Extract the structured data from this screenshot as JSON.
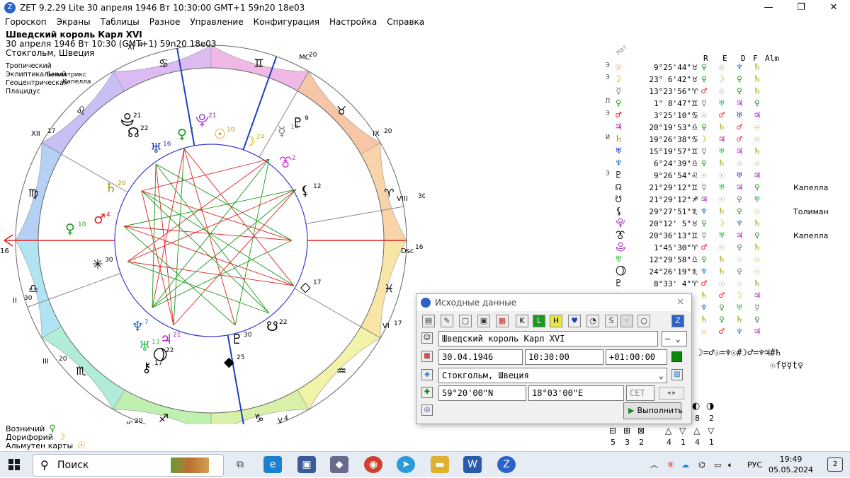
{
  "window": {
    "title": "ZET 9.2.29 Lite   30 апреля 1946  Вт  10:30:00 GMT+1 59n20  18e03",
    "minimize": "—",
    "maximize": "❐",
    "close": "✕"
  },
  "menu": [
    "Гороскоп",
    "Экраны",
    "Таблицы",
    "Разное",
    "Управление",
    "Конфигурация",
    "Настройка",
    "Справка"
  ],
  "chart_header": {
    "name": "Шведский король Карл XVI",
    "datetime": "30 апреля 1946  Вт  10:30 (GMT+1) 59n20  18e03",
    "place": "Стокгольм, Швеция"
  },
  "calc_settings": [
    "Тропический",
    "Эклиптикальный",
    "Геоцентрическая",
    "Плацидус"
  ],
  "fixed_stars_left": [
    "Беллатрикс",
    "Капелла"
  ],
  "wheel": {
    "asc_label": "Asc",
    "asc_deg": "16",
    "dsc_label": "Dsc",
    "dsc_deg": "16",
    "mc_label": "MC",
    "mc_deg": "20",
    "ic_label": "IC",
    "ic_deg": "20",
    "houses": [
      {
        "num": "II",
        "deg": "30"
      },
      {
        "num": "III",
        "deg": "20"
      },
      {
        "num": "V",
        "deg": "4"
      },
      {
        "num": "VI",
        "deg": "17"
      },
      {
        "num": "VIII",
        "deg": "30"
      },
      {
        "num": "IX",
        "deg": "20"
      },
      {
        "num": "XI",
        "deg": "4"
      },
      {
        "num": "XII",
        "deg": "17"
      }
    ],
    "star_bottom": "Толиман",
    "planets_on_wheel": [
      {
        "glyph": "♀",
        "deg": "10",
        "color": "#1a9a1a"
      },
      {
        "glyph": "♂",
        "deg": "4",
        "color": "#e02020"
      },
      {
        "glyph": "♄",
        "deg": "20",
        "color": "#999900"
      },
      {
        "glyph": "☊",
        "deg": "22",
        "color": "#000"
      },
      {
        "glyph": "♅",
        "deg": "16",
        "color": "#1a40c0"
      },
      {
        "glyph": "♀",
        "deg": "2",
        "color": "#1a9a1a"
      },
      {
        "glyph": "⯓",
        "deg": "21",
        "color": "#9a30c0"
      },
      {
        "glyph": "☉",
        "deg": "10",
        "color": "#e08a00"
      },
      {
        "glyph": "☽",
        "deg": "24",
        "color": "#d4b000"
      },
      {
        "glyph": "☿",
        "deg": "14",
        "color": "#888"
      },
      {
        "glyph": "♇",
        "deg": "9",
        "color": "#000"
      },
      {
        "glyph": "⯔",
        "deg": "2",
        "color": "#e020e0"
      },
      {
        "glyph": "⚸",
        "deg": "12",
        "color": "#000"
      },
      {
        "glyph": "✳",
        "deg": "30",
        "color": "#000"
      },
      {
        "glyph": "◇",
        "deg": "17",
        "color": "#000"
      },
      {
        "glyph": "☋",
        "deg": "22",
        "color": "#000"
      },
      {
        "glyph": "♇",
        "deg": "30",
        "color": "#000"
      },
      {
        "glyph": "◆",
        "deg": "25",
        "color": "#000"
      },
      {
        "glyph": "♃",
        "deg": "21",
        "color": "#b020c0"
      },
      {
        "glyph": "♆",
        "deg": "7",
        "color": "#1a70d0"
      },
      {
        "glyph": "♅",
        "deg": "13",
        "color": "#20c040"
      },
      {
        "glyph": "⚷",
        "deg": "17",
        "color": "#000"
      },
      {
        "glyph": "⯕",
        "deg": "21",
        "color": "#000"
      },
      {
        "glyph": "⯖",
        "deg": "22",
        "color": "#000"
      }
    ]
  },
  "bottom_info": [
    {
      "label": "Возничий",
      "glyph": "♀",
      "color": "#1a9a1a"
    },
    {
      "label": "Дорифорий",
      "glyph": "☽",
      "color": "#d4b000"
    },
    {
      "label": "Альмутен карты",
      "glyph": "☉",
      "color": "#e08a00"
    }
  ],
  "table": {
    "header_nat": "Нат",
    "col_headers": [
      "R",
      "E",
      "D",
      "F",
      "Alm"
    ],
    "rows": [
      {
        "pre": "Э",
        "glyph": "☉",
        "gcol": "#e08a00",
        "deg": "9°25'44\"",
        "sign": "♉",
        "r": [
          "♀",
          "☉",
          "♆",
          "♄"
        ],
        "rc": [
          "#1a9a1a",
          "#e08a00",
          "#1a70d0",
          "#999900"
        ],
        "star": ""
      },
      {
        "pre": "Э",
        "glyph": "☽",
        "gcol": "#d4b000",
        "deg": "23° 6'42\"",
        "sign": "♉",
        "r": [
          "♀",
          "☽",
          "♀",
          "♄"
        ],
        "rc": [
          "#1a9a1a",
          "#d4b000",
          "#1a9a1a",
          "#999900"
        ],
        "star": ""
      },
      {
        "pre": "",
        "glyph": "☿",
        "gcol": "#888",
        "deg": "13°23'56\"",
        "sign": "♈",
        "r": [
          "♂",
          "☉",
          "♀",
          "♄"
        ],
        "rc": [
          "#e02020",
          "#e08a00",
          "#1a9a1a",
          "#999900"
        ],
        "star": ""
      },
      {
        "pre": "П",
        "glyph": "♀",
        "gcol": "#1a9a1a",
        "deg": "1° 8'47\"",
        "sign": "♊",
        "r": [
          "☿",
          "♅",
          "♃",
          "♀"
        ],
        "rc": [
          "#888",
          "#20c040",
          "#b020c0",
          "#1a9a1a"
        ],
        "star": ""
      },
      {
        "pre": "Э",
        "glyph": "♂",
        "gcol": "#e02020",
        "deg": "3°25'10\"",
        "sign": "♋",
        "r": [
          "☉",
          "♂",
          "♅",
          "♃"
        ],
        "rc": [
          "#e08a00",
          "#e02020",
          "#1a40c0",
          "#b020c0"
        ],
        "star": ""
      },
      {
        "pre": "",
        "glyph": "♃",
        "gcol": "#b020c0",
        "deg": "20°19'53\"",
        "sign": "♎",
        "r": [
          "♀",
          "♄",
          "♂",
          "☉"
        ],
        "rc": [
          "#1a9a1a",
          "#999900",
          "#e02020",
          "#e08a00"
        ],
        "star": ""
      },
      {
        "pre": "И",
        "glyph": "♄",
        "gcol": "#999900",
        "deg": "19°26'38\"",
        "sign": "♋",
        "r": [
          "☽",
          "♃",
          "♂",
          "☉"
        ],
        "rc": [
          "#d4b000",
          "#b020c0",
          "#e02020",
          "#e08a00"
        ],
        "star": ""
      },
      {
        "pre": "",
        "glyph": "♅",
        "gcol": "#1a40c0",
        "deg": "15°19'57\"",
        "sign": "♊",
        "r": [
          "☿",
          "♅",
          "♃",
          "♄"
        ],
        "rc": [
          "#888",
          "#20c040",
          "#b020c0",
          "#999900"
        ],
        "star": ""
      },
      {
        "pre": "",
        "glyph": "♆",
        "gcol": "#1a70d0",
        "deg": "6°24'39\"",
        "sign": "♎",
        "r": [
          "♀",
          "♄",
          "☉",
          "☉"
        ],
        "rc": [
          "#1a9a1a",
          "#999900",
          "#e08a00",
          "#e08a00"
        ],
        "star": ""
      },
      {
        "pre": "Э",
        "glyph": "♇",
        "gcol": "#000",
        "deg": "9°26'54\"",
        "sign": "♌",
        "r": [
          "☉",
          "☉",
          "♅",
          "♃"
        ],
        "rc": [
          "#e08a00",
          "#e08a00",
          "#1a40c0",
          "#b020c0"
        ],
        "star": ""
      },
      {
        "pre": "",
        "glyph": "☊",
        "gcol": "#000",
        "deg": "21°29'12\"",
        "sign": "♊",
        "r": [
          "☿",
          "♅",
          "♃",
          "♀"
        ],
        "rc": [
          "#888",
          "#20c040",
          "#b020c0",
          "#1a9a1a"
        ],
        "star": "Капелла"
      },
      {
        "pre": "",
        "glyph": "☋",
        "gcol": "#000",
        "deg": "21°29'12\"",
        "sign": "♐",
        "r": [
          "♃",
          "☉",
          "♀",
          "♅"
        ],
        "rc": [
          "#b020c0",
          "#e08a00",
          "#1a9a1a",
          "#20c040"
        ],
        "star": ""
      },
      {
        "pre": "",
        "glyph": "⚸",
        "gcol": "#000",
        "deg": "29°27'51\"",
        "sign": "♏",
        "r": [
          "♆",
          "♄",
          "♀",
          "☉"
        ],
        "rc": [
          "#1a70d0",
          "#999900",
          "#1a9a1a",
          "#e08a00"
        ],
        "star": "Толиман"
      },
      {
        "pre": "",
        "glyph": "⯓",
        "gcol": "#9a30c0",
        "deg": "20°12' 5\"",
        "sign": "♉",
        "r": [
          "♀",
          "☽",
          "♆",
          "♄"
        ],
        "rc": [
          "#1a9a1a",
          "#d4b000",
          "#1a70d0",
          "#999900"
        ],
        "star": ""
      },
      {
        "pre": "",
        "glyph": "⯔",
        "gcol": "#000",
        "deg": "20°36'13\"",
        "sign": "♊",
        "r": [
          "☿",
          "♅",
          "♃",
          "♀"
        ],
        "rc": [
          "#888",
          "#20c040",
          "#b020c0",
          "#1a9a1a"
        ],
        "star": "Капелла"
      },
      {
        "pre": "",
        "glyph": "⯕",
        "gcol": "#9a30c0",
        "deg": "1°45'30\"",
        "sign": "♈",
        "r": [
          "♂",
          "☉",
          "♀",
          "♄"
        ],
        "rc": [
          "#e02020",
          "#e08a00",
          "#1a9a1a",
          "#999900"
        ],
        "star": ""
      },
      {
        "pre": "",
        "glyph": "♅",
        "gcol": "#20c040",
        "deg": "12°29'58\"",
        "sign": "♎",
        "r": [
          "♀",
          "♄",
          "☉",
          "☉"
        ],
        "rc": [
          "#1a9a1a",
          "#999900",
          "#e08a00",
          "#e08a00"
        ],
        "star": ""
      },
      {
        "pre": "",
        "glyph": "⯖",
        "gcol": "#000",
        "deg": "24°26'19\"",
        "sign": "♏",
        "r": [
          "♆",
          "♄",
          "♀",
          "☉"
        ],
        "rc": [
          "#1a70d0",
          "#999900",
          "#1a9a1a",
          "#e08a00"
        ],
        "star": ""
      },
      {
        "pre": "",
        "glyph": "♇",
        "gcol": "#000",
        "deg": "8°33' 4\"",
        "sign": "♈",
        "r": [
          "♂",
          "☉",
          "☉",
          "♄"
        ],
        "rc": [
          "#e02020",
          "#e08a00",
          "#e08a00",
          "#999900"
        ],
        "star": ""
      },
      {
        "pre": "",
        "glyph": "◇",
        "gcol": "#000",
        "deg": "",
        "sign": "",
        "r": [
          "♄",
          "♂",
          "☽",
          "♃"
        ],
        "rc": [
          "#999900",
          "#e02020",
          "#d4b000",
          "#b020c0"
        ],
        "star": ""
      },
      {
        "pre": "",
        "glyph": "",
        "gcol": "#000",
        "deg": "",
        "sign": "",
        "r": [
          "♆",
          "♀",
          "♅",
          "☿"
        ],
        "rc": [
          "#1a70d0",
          "#1a9a1a",
          "#20c040",
          "#888"
        ],
        "star": ""
      },
      {
        "pre": "",
        "glyph": "",
        "gcol": "#000",
        "deg": "",
        "sign": "",
        "r": [
          "♄",
          "♀",
          "♄",
          "♀"
        ],
        "rc": [
          "#999900",
          "#1a9a1a",
          "#999900",
          "#1a9a1a"
        ],
        "star": ""
      },
      {
        "pre": "",
        "glyph": "",
        "gcol": "#000",
        "deg": "",
        "sign": "",
        "r": [
          "☉",
          "♂",
          "♆",
          "♃"
        ],
        "rc": [
          "#e08a00",
          "#e02020",
          "#1a70d0",
          "#b020c0"
        ],
        "star": ""
      }
    ],
    "formula1": "☽=♂☉=♆☉#☽♂=♆♃#♄",
    "formula2": "☉f☿☿t♀"
  },
  "bottom_right": {
    "row1_icons": [
      "◐",
      "◑"
    ],
    "row1_nums": [
      "8",
      "2"
    ],
    "row2_icons": [
      "⊟",
      "⊞",
      "⊠",
      "△",
      "▽",
      "△",
      "▽"
    ],
    "row2_nums": [
      "5",
      "3",
      "2",
      "4",
      "1",
      "4",
      "1"
    ]
  },
  "dialog": {
    "title": "Исходные данные",
    "close": "✕",
    "name_value": "Шведский король Карл XVI",
    "gender_value": "—",
    "date_value": "30.04.1946",
    "time_value": "10:30:00",
    "tz_value": "+01:00:00",
    "place_value": "Стокгольм, Швеция",
    "lat_value": "59°20'00\"N",
    "lon_value": "18°03'00\"E",
    "tzcode_value": "CET",
    "run_label": "Выполнить",
    "toolbar": [
      "▤",
      "✎",
      "▢",
      "▣",
      "▦",
      "K",
      "L",
      "H",
      "♥",
      "◔",
      "S",
      "◦",
      "○",
      "Z"
    ]
  },
  "taskbar": {
    "search_placeholder": "Поиск",
    "lang": "РУС",
    "time": "19:49",
    "date": "05.05.2024",
    "notif_count": "2"
  }
}
